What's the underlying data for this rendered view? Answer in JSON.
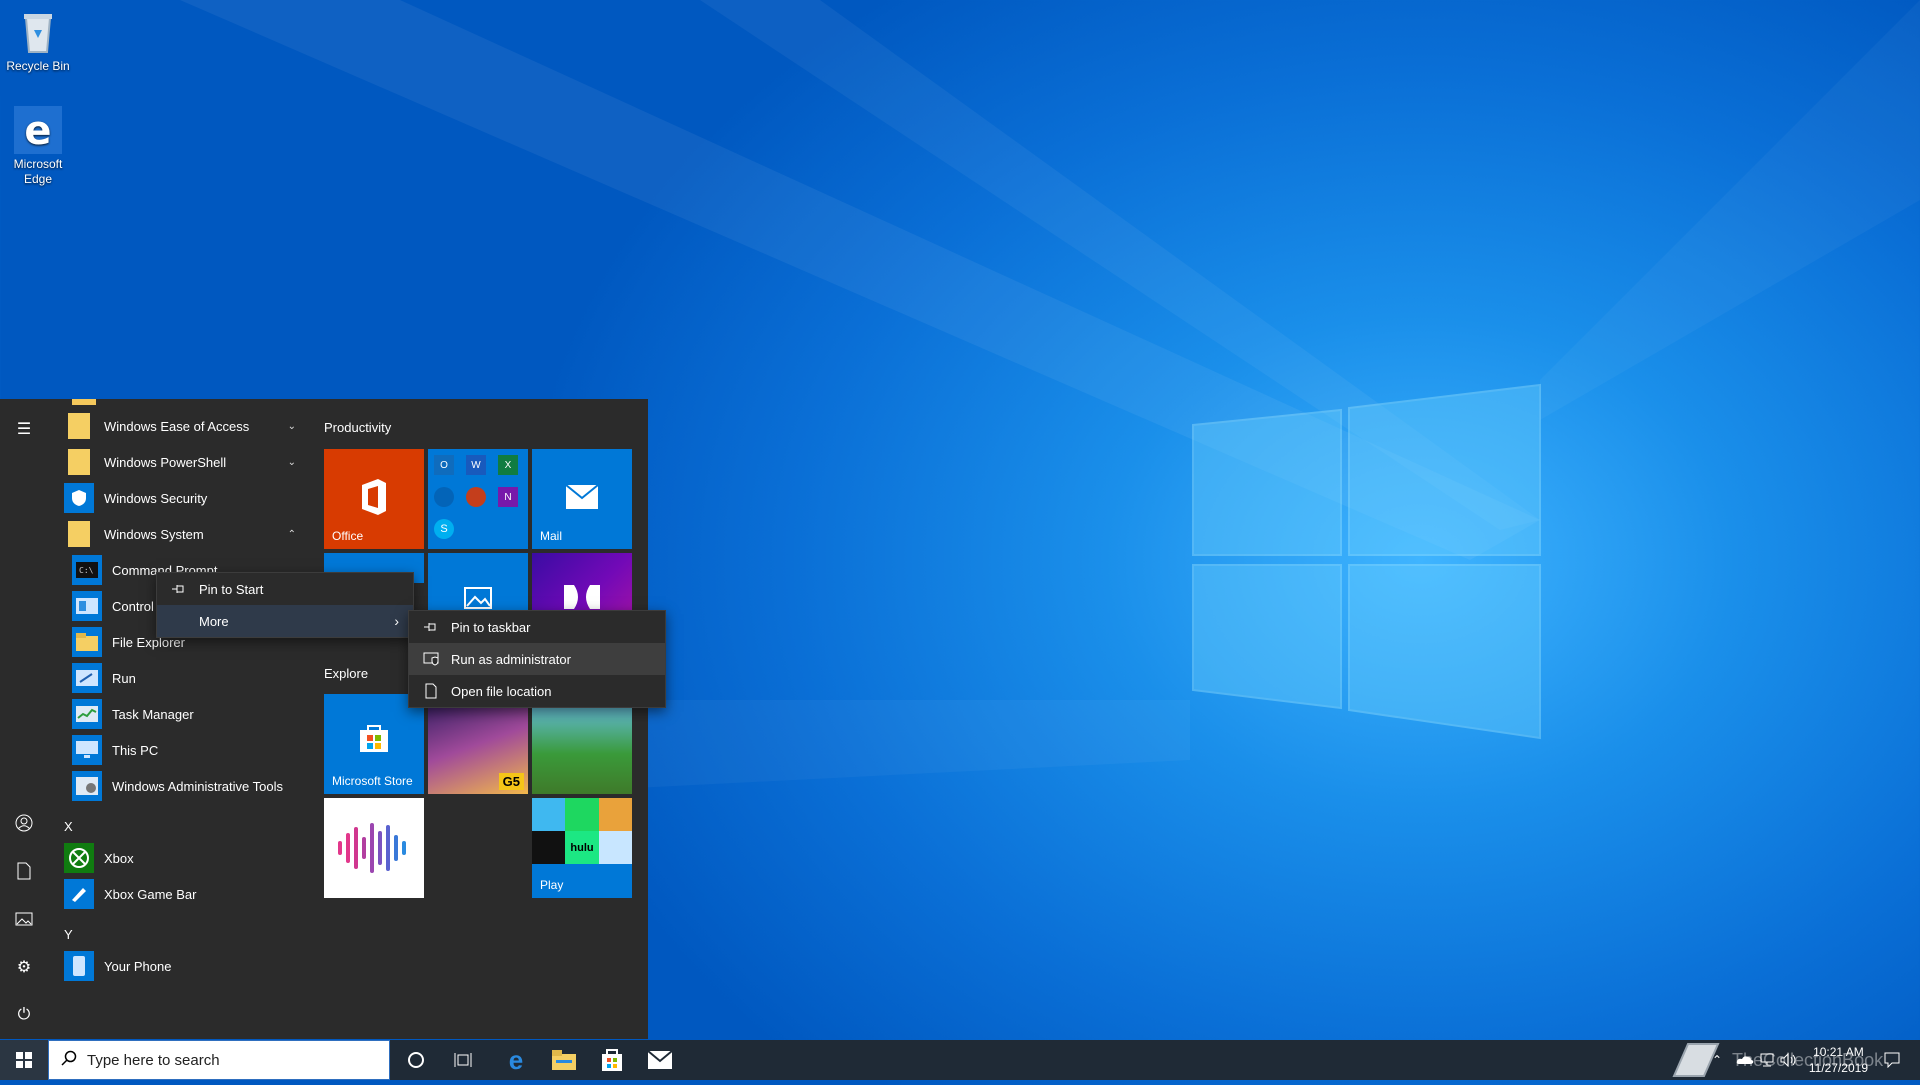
{
  "desktop": {
    "icons": [
      {
        "label": "Recycle Bin",
        "icon": "recycle-bin-icon"
      },
      {
        "label": "Microsoft Edge",
        "icon": "edge-icon"
      }
    ]
  },
  "start_menu": {
    "apps": [
      {
        "label": "Windows Ease of Access",
        "icon": "folder-icon",
        "expand": "collapsed"
      },
      {
        "label": "Windows PowerShell",
        "icon": "folder-icon",
        "expand": "collapsed"
      },
      {
        "label": "Windows Security",
        "icon": "shield-icon"
      },
      {
        "label": "Windows System",
        "icon": "folder-icon",
        "expand": "expanded"
      },
      {
        "label": "Command Prompt",
        "icon": "command-prompt-icon"
      },
      {
        "label": "Control Panel",
        "icon": "control-panel-icon"
      },
      {
        "label": "File Explorer",
        "icon": "file-explorer-icon"
      },
      {
        "label": "Run",
        "icon": "run-icon"
      },
      {
        "label": "Task Manager",
        "icon": "task-manager-icon"
      },
      {
        "label": "This PC",
        "icon": "this-pc-icon"
      },
      {
        "label": "Windows Administrative Tools",
        "icon": "admin-tools-icon"
      },
      {
        "label": "Xbox",
        "icon": "xbox-icon"
      },
      {
        "label": "Xbox Game Bar",
        "icon": "xbox-game-bar-icon"
      },
      {
        "label": "Your Phone",
        "icon": "your-phone-icon"
      }
    ],
    "letters": [
      "X",
      "Y"
    ],
    "groups": {
      "productivity": "Productivity",
      "explore": "Explore"
    },
    "tiles": {
      "office": "Office",
      "mail": "Mail",
      "store": "Microsoft Store",
      "play": "Play"
    }
  },
  "context_menu": {
    "items": [
      {
        "label": "Pin to Start",
        "icon": "pin-icon"
      },
      {
        "label": "More",
        "icon": "",
        "submenu": true
      }
    ]
  },
  "submenu": {
    "items": [
      {
        "label": "Pin to taskbar",
        "icon": "pin-icon"
      },
      {
        "label": "Run as administrator",
        "icon": "shield-admin-icon"
      },
      {
        "label": "Open file location",
        "icon": "document-icon"
      }
    ]
  },
  "taskbar": {
    "search_placeholder": "Type here to search",
    "clock_time": "10:21 AM",
    "clock_date": "11/27/2019"
  },
  "watermark": "TheCollectionBook",
  "colors": {
    "accent": "#0078d7",
    "office": "#d83b01",
    "tile_blue": "#0078d7",
    "menu_bg": "#2b2b2b"
  }
}
